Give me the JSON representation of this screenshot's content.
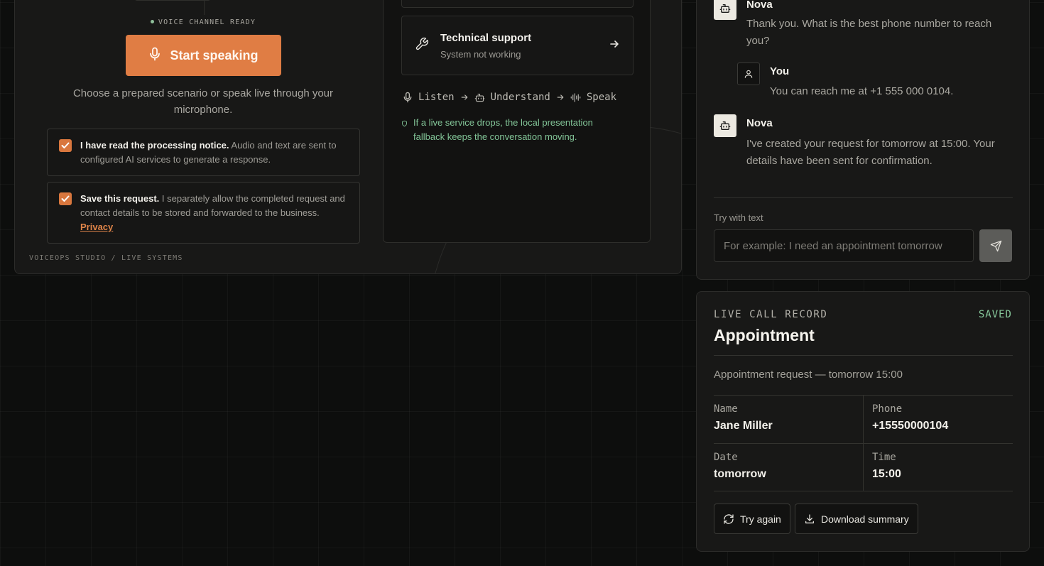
{
  "hero": {
    "status": "VOICE CHANNEL READY",
    "start_label": "Start speaking",
    "intro": "Choose a prepared scenario or speak live through your microphone.",
    "consent_processing_title": "I have read the processing notice.",
    "consent_processing_text": " Audio and text are sent to configured AI services to generate a response.",
    "consent_save_title": "Save this request.",
    "consent_save_text": " I separately allow the completed request and contact details to be stored and forwarded to the business. ",
    "privacy_link": "Privacy",
    "footer": "VOICEOPS STUDIO / LIVE SYSTEMS"
  },
  "scenario": {
    "title": "Technical support",
    "subtitle": "System not working"
  },
  "pipeline": {
    "steps": [
      "Listen",
      "Understand",
      "Speak"
    ]
  },
  "fallback_note": "If a live service drops, the local presentation fallback keeps the conversation moving.",
  "chat": {
    "messages": [
      {
        "speaker": "Nova",
        "role": "bot",
        "text": "Thank you. What is the best phone number to reach you?"
      },
      {
        "speaker": "You",
        "role": "user",
        "text": "You can reach me at +1 555 000 0104."
      },
      {
        "speaker": "Nova",
        "role": "bot",
        "text": "I've created your request for tomorrow at 15:00. Your details have been sent for confirmation."
      }
    ],
    "try_label": "Try with text",
    "input_placeholder": "For example: I need an appointment tomorrow",
    "input_value": ""
  },
  "record": {
    "kicker": "LIVE CALL RECORD",
    "status": "SAVED",
    "title": "Appointment",
    "summary": "Appointment request — tomorrow 15:00",
    "fields": [
      {
        "label": "Name",
        "value": "Jane Miller"
      },
      {
        "label": "Phone",
        "value": "+15550000104"
      },
      {
        "label": "Date",
        "value": "tomorrow"
      },
      {
        "label": "Time",
        "value": "15:00"
      }
    ],
    "try_again_label": "Try again",
    "download_label": "Download summary"
  },
  "colors": {
    "accent": "#e07d44",
    "success": "#86c79a",
    "background": "#0d0e0d",
    "panel": "#181817"
  },
  "icons": [
    "microphone-icon",
    "check-icon",
    "wrench-icon",
    "arrow-right-icon",
    "bot-icon",
    "user-icon",
    "send-icon",
    "refresh-icon",
    "download-icon",
    "waveform-icon",
    "shield-icon"
  ]
}
